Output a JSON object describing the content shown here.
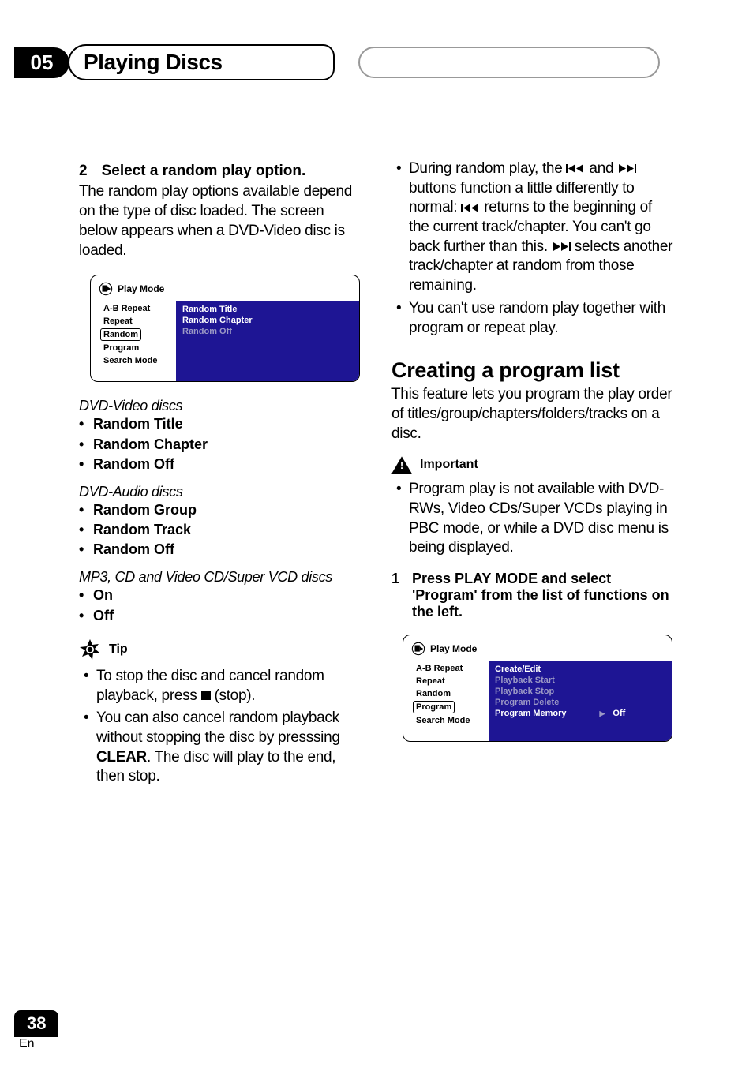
{
  "header": {
    "chapter_num": "05",
    "chapter_title": "Playing Discs"
  },
  "left_col": {
    "step2": {
      "num": "2",
      "title": "Select a random play option.",
      "body": "The random play options available depend on the type of disc loaded. The screen below appears when a DVD-Video disc is loaded."
    },
    "menu1": {
      "title": "Play Mode",
      "left_items": [
        "A-B Repeat",
        "Repeat",
        "Random",
        "Program",
        "Search Mode"
      ],
      "selected_index": 2,
      "right_items": [
        {
          "label": "Random Title",
          "dim": false
        },
        {
          "label": "Random Chapter",
          "dim": false
        },
        {
          "label": "Random Off",
          "dim": true
        }
      ]
    },
    "dvd_video_caption": "DVD-Video discs",
    "dvd_video_list": [
      "Random Title",
      "Random Chapter",
      "Random Off"
    ],
    "dvd_audio_caption": "DVD-Audio discs",
    "dvd_audio_list": [
      "Random Group",
      "Random Track",
      "Random Off"
    ],
    "mp3_caption": "MP3, CD and Video CD/Super VCD discs",
    "mp3_list": [
      "On",
      "Off"
    ],
    "tip_label": "Tip",
    "tip_items": [
      {
        "pre": "To stop the disc and cancel random playback, press ",
        "icon": "stop",
        "post": " (stop)."
      },
      {
        "pre": "You can also cancel random playback without stopping the disc by presssing ",
        "bold": "CLEAR",
        "post2": ". The disc will play to the end, then stop."
      }
    ]
  },
  "right_col": {
    "top_bullets": [
      {
        "pre": "During random play, the ",
        "i1": "prev",
        "mid1": " and ",
        "i2": "next",
        "mid2": " buttons function a little differently to normal: ",
        "i3": "prev",
        "mid3": " returns to the beginning of the current track/chapter. You can't go back further than this. ",
        "i4": "next",
        "post": " selects another track/chapter at random from those remaining."
      },
      {
        "plain": "You can't use random play together with program or repeat play."
      }
    ],
    "h2": "Creating a program list",
    "h2_body": "This feature lets you program the play order of titles/group/chapters/folders/tracks on a disc.",
    "important_label": "Important",
    "important_items": [
      "Program play is not available with DVD-RWs, Video CDs/Super VCDs playing in PBC mode, or while a DVD disc menu is being displayed."
    ],
    "step1": {
      "num": "1",
      "title": "Press PLAY MODE and select 'Program' from the list of functions on the left."
    },
    "menu2": {
      "title": "Play Mode",
      "left_items": [
        "A-B Repeat",
        "Repeat",
        "Random",
        "Program",
        "Search Mode"
      ],
      "selected_index": 3,
      "right_items": [
        {
          "label": "Create/Edit",
          "dim": false
        },
        {
          "label": "Playback Start",
          "dim": true
        },
        {
          "label": "Playback Stop",
          "dim": true
        },
        {
          "label": "Program Delete",
          "dim": true
        },
        {
          "label": "Program Memory",
          "dim": false,
          "extra": "Off"
        }
      ]
    }
  },
  "footer": {
    "page_num": "38",
    "lang": "En"
  }
}
